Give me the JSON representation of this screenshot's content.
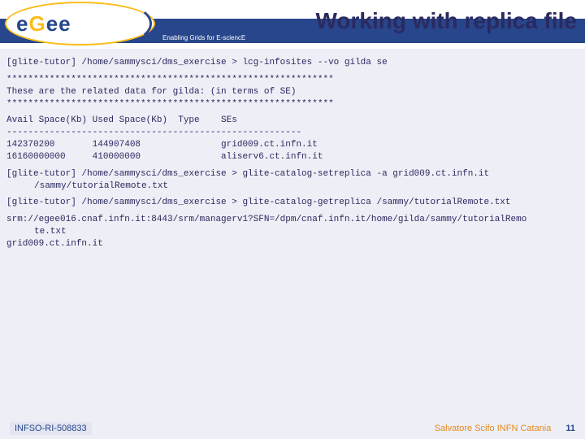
{
  "header": {
    "logo_text_parts": [
      "e",
      "G",
      "ee"
    ],
    "tagline": "Enabling Grids for E-sciencE",
    "title": "Working with replica file"
  },
  "lines": {
    "l1": "[glite-tutor] /home/sammysci/dms_exercise > lcg-infosites --vo gilda se",
    "l2": "*************************************************************",
    "l3": "These are the related data for gilda: (in terms of SE)",
    "l4": "*************************************************************",
    "l5": "Avail Space(Kb) Used Space(Kb)  Type    SEs",
    "l6": "-------------------------------------------------------",
    "l7": "142370200       144907408               grid009.ct.infn.it",
    "l8": "16160000000     410000000               aliserv6.ct.infn.it",
    "l9a": "[glite-tutor] /home/sammysci/dms_exercise > glite-catalog-setreplica -a grid009.ct.infn.it",
    "l9b": "/sammy/tutorialRemote.txt",
    "l10": "[glite-tutor] /home/sammysci/dms_exercise > glite-catalog-getreplica /sammy/tutorialRemote.txt",
    "l11a": "srm://egee016.cnaf.infn.it:8443/srm/managerv1?SFN=/dpm/cnaf.infn.it/home/gilda/sammy/tutorialRemo",
    "l11b": "te.txt",
    "l12": "grid009.ct.infn.it"
  },
  "footer": {
    "left": "INFSO-RI-508833",
    "right": "Salvatore Scifo INFN Catania",
    "page": "11"
  }
}
